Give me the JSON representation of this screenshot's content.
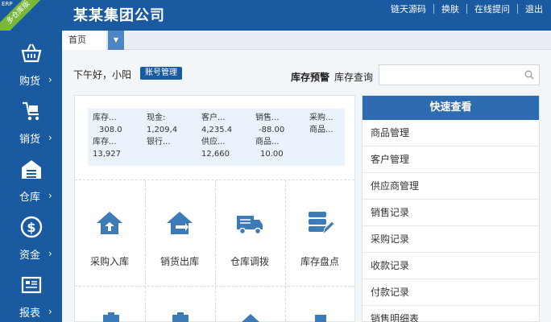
{
  "header": {
    "ribbon": "多仓库版",
    "ribbon_tag": "ERP",
    "company": "某某集团公司",
    "links": [
      "链天源码",
      "换肤",
      "在线提问",
      "退出"
    ]
  },
  "sidebar": {
    "items": [
      {
        "label": "购货",
        "icon": "basket-icon"
      },
      {
        "label": "销货",
        "icon": "cart-icon"
      },
      {
        "label": "仓库",
        "icon": "warehouse-icon"
      },
      {
        "label": "资金",
        "icon": "dollar-icon"
      },
      {
        "label": "报表",
        "icon": "report-icon"
      }
    ],
    "arrow": "›"
  },
  "tabs": {
    "home": "首页"
  },
  "greeting": {
    "text": "下午好，小阳",
    "account_button": "账号管理",
    "stock_warning": "库存预警",
    "stock_query": "库存查询",
    "search_value": ""
  },
  "stats": [
    {
      "l1": "库存...",
      "v1": "308.0",
      "l2": "库存...",
      "v2": "13,927"
    },
    {
      "l1": "现金:",
      "v1": "1,209,4",
      "l2": "银行...",
      "v2": ""
    },
    {
      "l1": "客户...",
      "v1": "4,235.4",
      "l2": "供应...",
      "v2": "12,660"
    },
    {
      "l1": "销售...",
      "v1": "-88.00",
      "l2": "商品...",
      "v2": "10.00"
    },
    {
      "l1": "采购...",
      "v1": "",
      "l2": "商品...",
      "v2": ""
    }
  ],
  "actions": [
    {
      "label": "采购入库",
      "icon": "purchase-in-icon"
    },
    {
      "label": "销货出库",
      "icon": "sales-out-icon"
    },
    {
      "label": "仓库调拨",
      "icon": "truck-icon"
    },
    {
      "label": "库存盘点",
      "icon": "inventory-count-icon"
    }
  ],
  "quick": {
    "title": "快速查看",
    "items": [
      "商品管理",
      "客户管理",
      "供应商管理",
      "销售记录",
      "采购记录",
      "收款记录",
      "付款记录",
      "销售明细表"
    ]
  },
  "colors": {
    "primary": "#1a5aa0",
    "accent": "#79b83b",
    "stat_bg": "#eaf3fb"
  }
}
